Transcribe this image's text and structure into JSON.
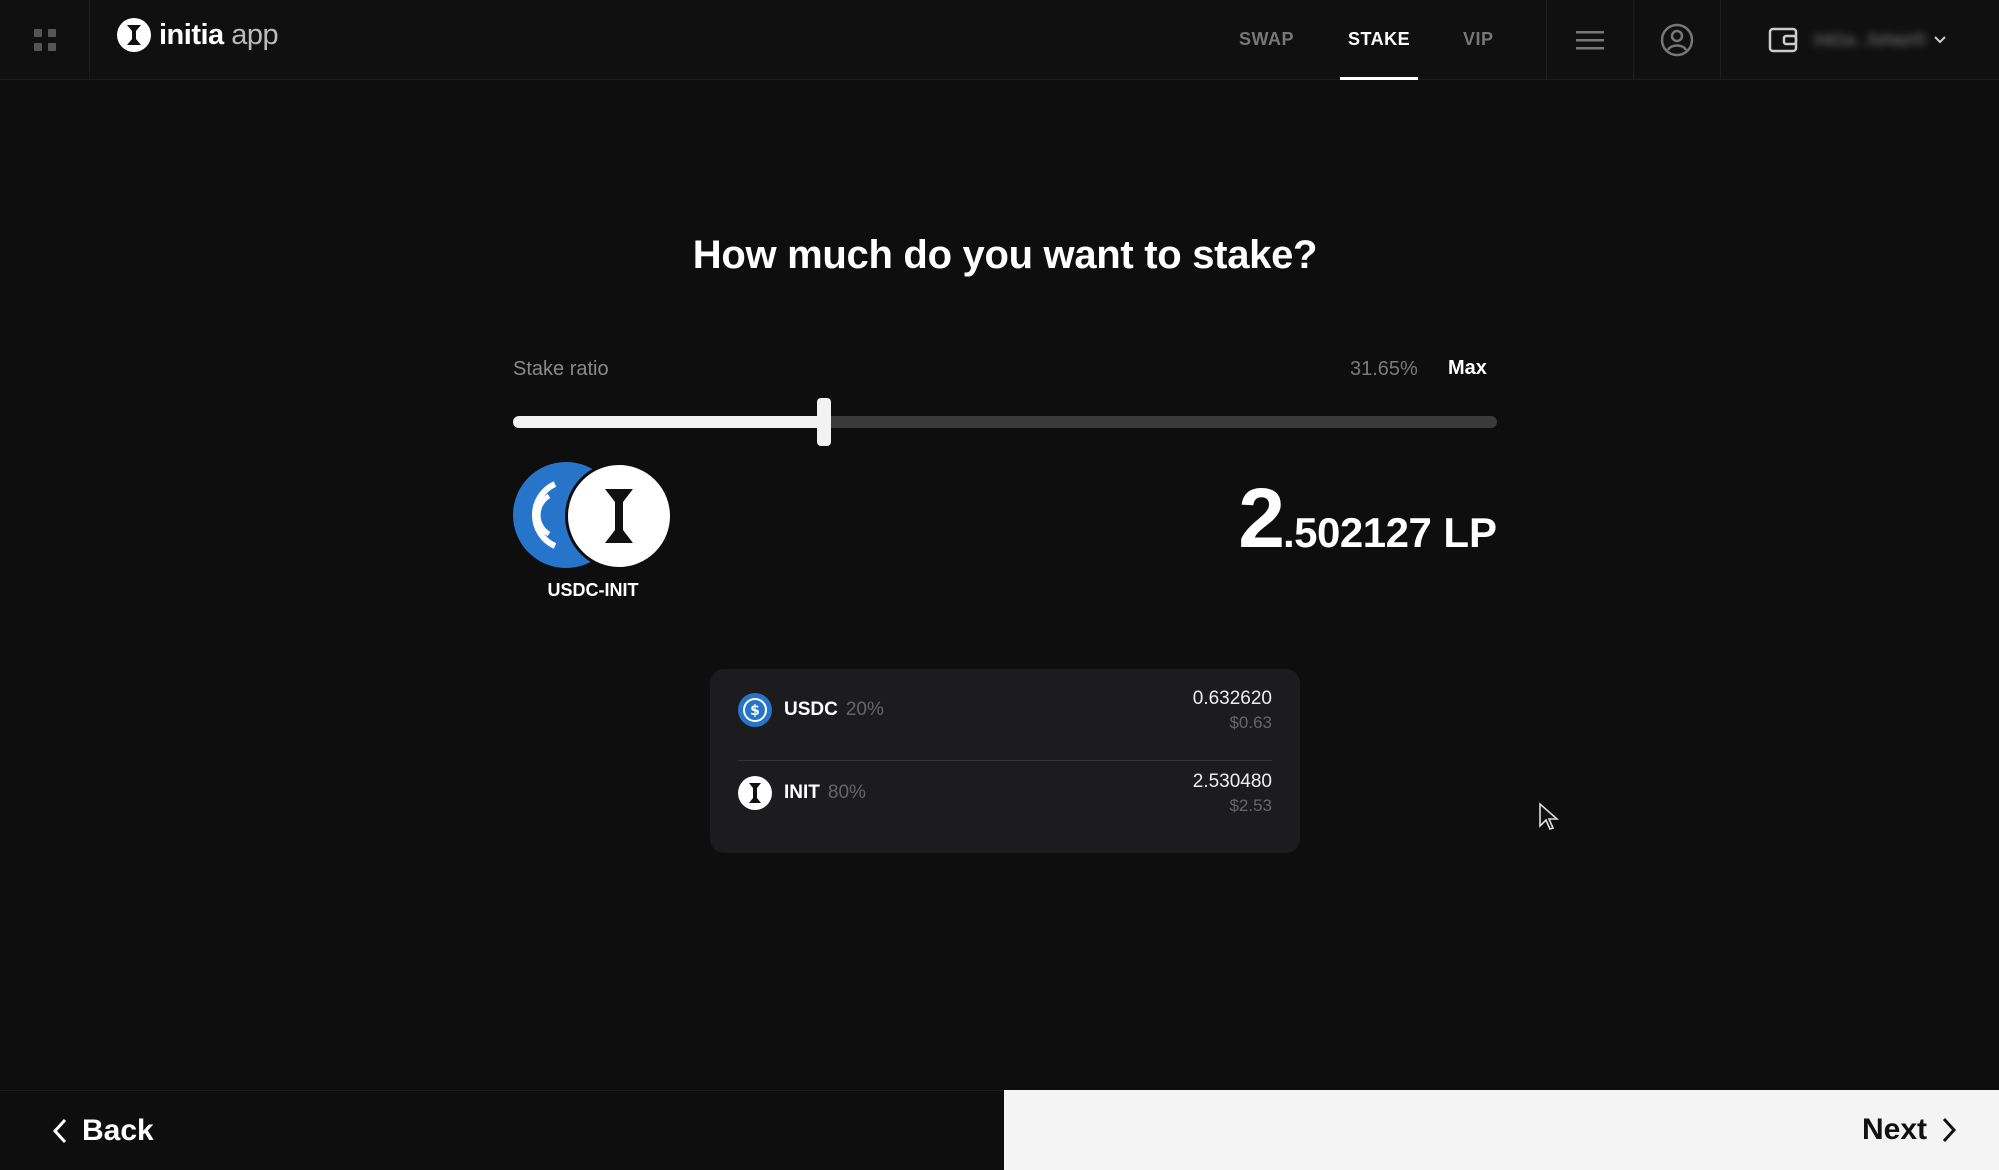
{
  "app": {
    "logo_bold": "initia",
    "logo_light": " app"
  },
  "nav": {
    "tabs": [
      {
        "label": "SWAP",
        "active": false
      },
      {
        "label": "STAKE",
        "active": true
      },
      {
        "label": "VIP",
        "active": false
      }
    ]
  },
  "wallet": {
    "address": "init1a...fuhazr0"
  },
  "main": {
    "title": "How much do you want to stake?",
    "ratio_label": "Stake ratio",
    "ratio_percent": "31.65%",
    "ratio_value": 0.3165,
    "max_label": "Max",
    "pair_name": "USDC-INIT",
    "lp_integer": "2",
    "lp_decimal": ".502127",
    "lp_unit": "LP"
  },
  "breakdown": [
    {
      "symbol": "USDC",
      "weight": "20%",
      "amount": "0.632620",
      "usd": "$0.63",
      "icon": "usdc-icon"
    },
    {
      "symbol": "INIT",
      "weight": "80%",
      "amount": "2.530480",
      "usd": "$2.53",
      "icon": "init-icon"
    }
  ],
  "footer": {
    "back_label": "Back",
    "next_label": "Next"
  },
  "colors": {
    "background": "#0e0e0e",
    "usdc_blue": "#2775ca",
    "card": "#1c1c1e",
    "next_bg": "#f4f4f4"
  }
}
